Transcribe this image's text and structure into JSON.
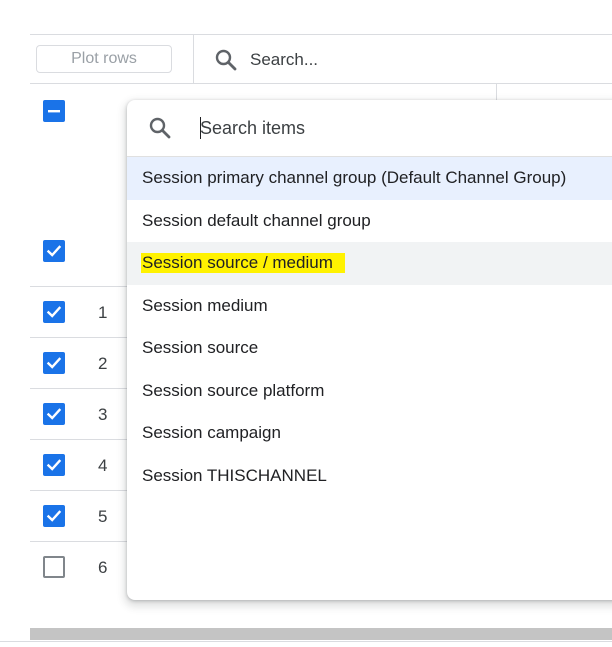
{
  "toolbar": {
    "plot_rows_label": "Plot rows",
    "search_placeholder": "Search..."
  },
  "table": {
    "rows": [
      {
        "num": "1",
        "checked": true
      },
      {
        "num": "2",
        "checked": true
      },
      {
        "num": "3",
        "checked": true
      },
      {
        "num": "4",
        "checked": true
      },
      {
        "num": "5",
        "checked": true
      },
      {
        "num": "6",
        "checked": false
      }
    ]
  },
  "dropdown": {
    "search_placeholder": "Search items",
    "items": [
      {
        "label": "Session primary channel group (Default Channel Group)",
        "state": "selected"
      },
      {
        "label": "Session default channel group",
        "state": ""
      },
      {
        "label": "Session source / medium",
        "state": "hovered highlighted"
      },
      {
        "label": "Session medium",
        "state": ""
      },
      {
        "label": "Session source",
        "state": ""
      },
      {
        "label": "Session source platform",
        "state": ""
      },
      {
        "label": "Session campaign",
        "state": ""
      },
      {
        "label": "Session THISCHANNEL",
        "state": ""
      }
    ]
  },
  "icons": {
    "search": "search-icon",
    "check": "check-icon",
    "indeterminate": "minus-icon"
  },
  "colors": {
    "accent": "#1a73e8",
    "selected_bg": "#e8f0fe",
    "hover_bg": "#f1f3f4",
    "highlight": "#fff200"
  }
}
